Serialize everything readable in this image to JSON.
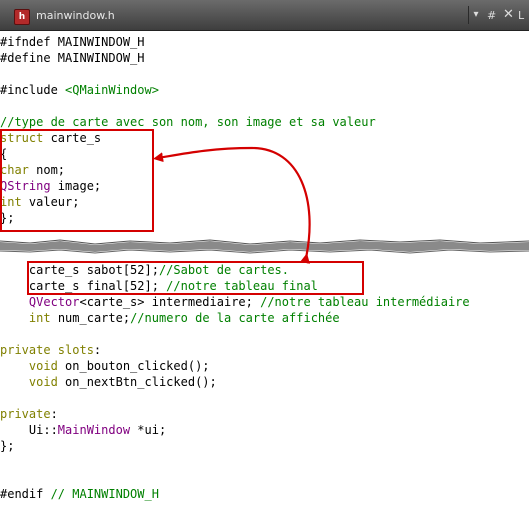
{
  "tab": {
    "icon_letter": "h",
    "filename": "mainwindow.h",
    "hash": "#",
    "close": "✕",
    "extra": "L"
  },
  "lines_top": [
    [
      "#ifndef MAINWINDOW_H"
    ],
    [
      "#define MAINWINDOW_H"
    ],
    [
      ""
    ],
    [
      "#include ",
      "<QMainWindow>"
    ],
    [
      ""
    ],
    [
      "//type de carte avec son nom, son image et sa valeur"
    ],
    [
      "struct",
      " carte_s"
    ],
    [
      "{"
    ],
    [
      "char",
      " nom;"
    ],
    [
      "QString",
      " image;"
    ],
    [
      "int",
      " valeur;"
    ],
    [
      "};"
    ]
  ],
  "lines_bottom": [
    [
      "    carte_s sabot[52];",
      "//Sabot de cartes."
    ],
    [
      "    carte_s final[52]; ",
      "//notre tableau final"
    ],
    [
      "    QVector",
      "<carte_s> intermediaire; ",
      "//notre tableau intermédiaire"
    ],
    [
      "    ",
      "int",
      " num_carte;",
      "//numero de la carte affichée"
    ],
    [
      ""
    ],
    [
      "private slots",
      ":"
    ],
    [
      "    ",
      "void",
      " on_bouton_clicked();"
    ],
    [
      "    ",
      "void",
      " on_nextBtn_clicked();"
    ],
    [
      ""
    ],
    [
      "private",
      ":"
    ],
    [
      "    Ui::",
      "MainWindow",
      " *ui;"
    ],
    [
      "};"
    ],
    [
      ""
    ],
    [
      ""
    ],
    [
      "#endif ",
      "// MAINWINDOW_H"
    ]
  ],
  "colors": {
    "annotation_red": "#d40000",
    "comment_green": "#008000",
    "keyword_olive": "#808000",
    "type_purple": "#800080"
  }
}
